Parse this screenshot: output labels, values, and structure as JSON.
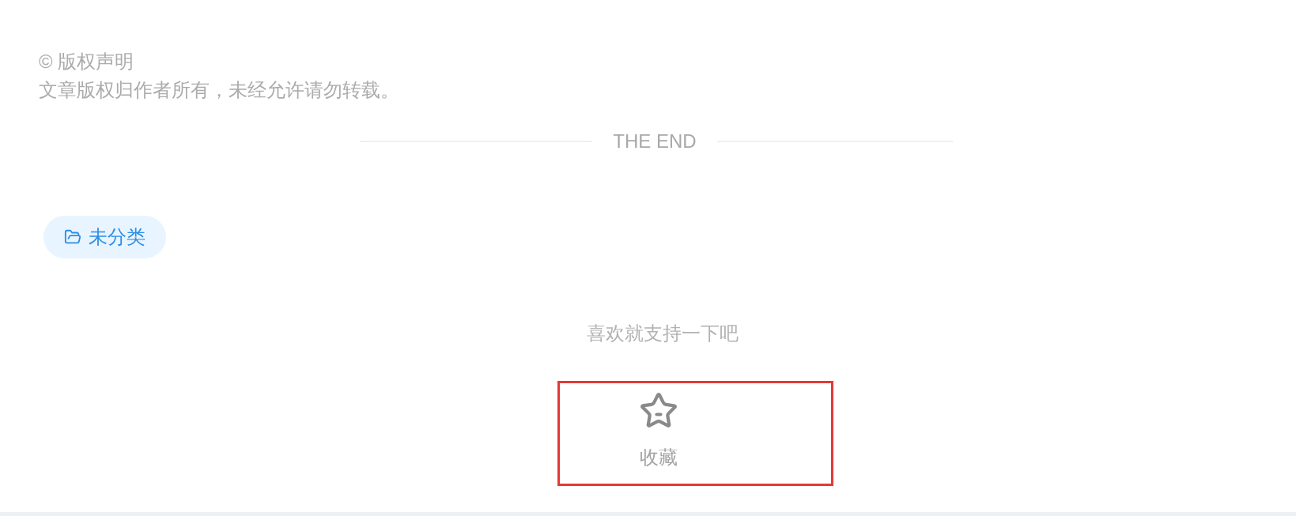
{
  "copyright": {
    "title": "© 版权声明",
    "notice": "文章版权归作者所有，未经允许请勿转载。"
  },
  "end_divider": {
    "label": "THE END"
  },
  "categories": [
    {
      "label": "未分类"
    }
  ],
  "support": {
    "prompt": "喜欢就支持一下吧",
    "actions": [
      {
        "kind": "favorite",
        "label": "收藏",
        "highlighted": true
      }
    ]
  }
}
